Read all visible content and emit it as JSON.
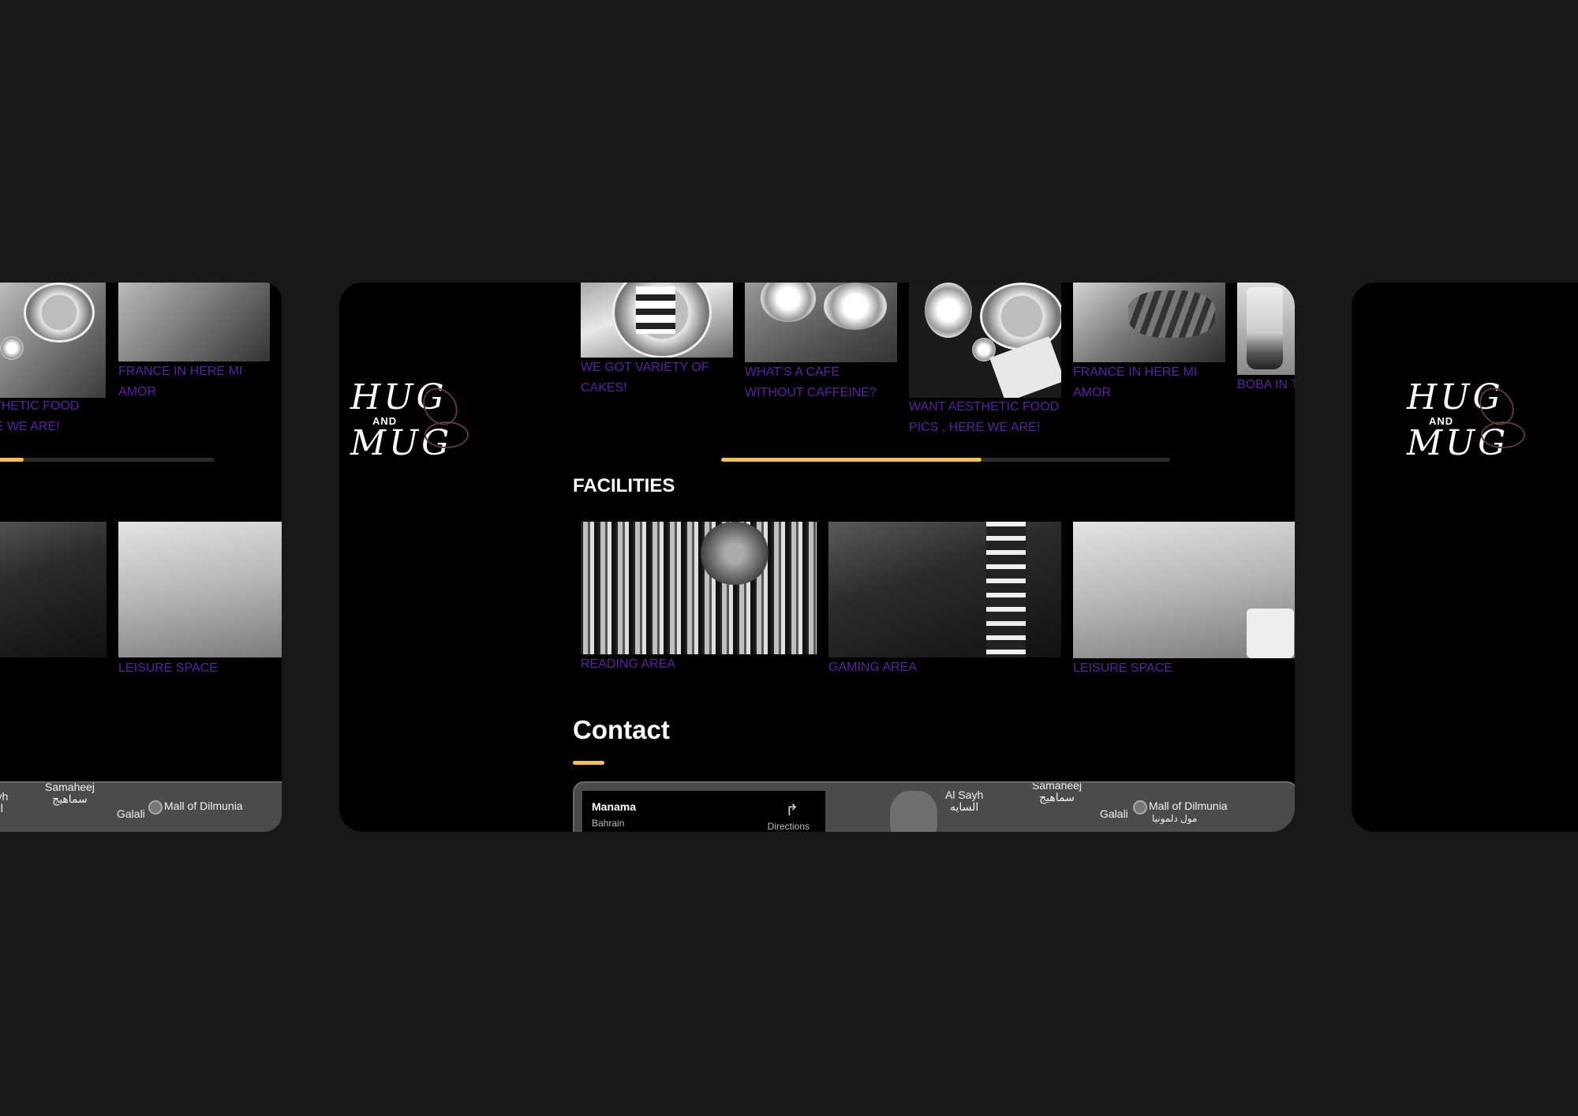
{
  "logo": {
    "line1": "HUG",
    "line2": "AND",
    "line3": "MUG"
  },
  "gallery": [
    {
      "caption": "WE GOT VARIETY OF CAKES!"
    },
    {
      "caption": "WHAT'S A CAFE WITHOUT CAFFEINE?"
    },
    {
      "caption": "WANT AESTHETIC FOOD PICS , HERE WE ARE!"
    },
    {
      "caption": "FRANCE IN HERE MI AMOR"
    },
    {
      "caption": "BOBA IN THE BOBA?"
    }
  ],
  "gallery_left_partial": [
    {
      "caption": "AESTHETIC FOOD\nHERE WE ARE!"
    },
    {
      "caption": "FRANCE IN HERE MI AMOR"
    }
  ],
  "gallery_slider": {
    "progress": 0.58
  },
  "facilities": {
    "title": "FACILITIES",
    "items": [
      {
        "caption": "READING AREA"
      },
      {
        "caption": "GAMING AREA"
      },
      {
        "caption": "LEISURE SPACE"
      }
    ]
  },
  "contact": {
    "title": "Contact",
    "map": {
      "place": "Manama",
      "country": "Bahrain",
      "directions": "Directions",
      "labels": {
        "al_sayh": "Al Sayh",
        "al_sayh_ar": "السايه",
        "samaheej": "Samaheej",
        "samaheej_ar": "سماهيج",
        "galali": "Galali",
        "mall": "Mall of Dilmunia",
        "mall_ar": "مول دلمونيا"
      }
    }
  },
  "colors": {
    "accent": "#f5c04d",
    "caption": "#5b1fa8",
    "background": "#181818",
    "card": "#000000"
  }
}
